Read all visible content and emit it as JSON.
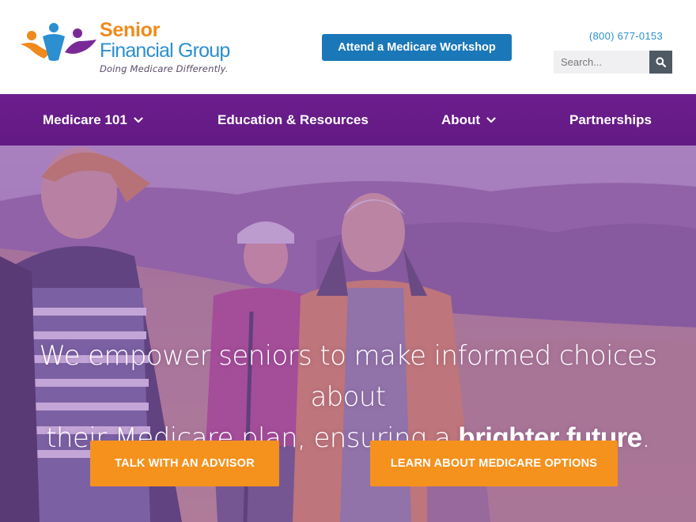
{
  "header": {
    "logo": {
      "word1": "Senior",
      "word2": "Financial Group",
      "tagline": "Doing Medicare Differently."
    },
    "workshop_button": "Attend a Medicare Workshop",
    "phone": "(800) 677-0153",
    "search": {
      "placeholder": "Search...",
      "value": ""
    }
  },
  "nav": {
    "items": [
      {
        "label": "Medicare 101",
        "has_dropdown": true
      },
      {
        "label": "Education & Resources",
        "has_dropdown": false
      },
      {
        "label": "About",
        "has_dropdown": true
      },
      {
        "label": "Partnerships",
        "has_dropdown": false
      }
    ]
  },
  "hero": {
    "line1": "We empower seniors to make informed choices about",
    "line2_a": "their Medicare plan, ensuring a ",
    "line2_b": "brighter future",
    "line2_c": ".",
    "cta_primary": "TALK WITH AN ADVISOR",
    "cta_secondary": "LEARN ABOUT MEDICARE OPTIONS"
  },
  "colors": {
    "brand_orange": "#f5921e",
    "brand_blue": "#2b8fd0",
    "brand_purple": "#6c1d8e",
    "button_blue": "#1a77b8"
  },
  "icons": {
    "search": "magnifier-icon",
    "dropdown": "chevron-down-icon",
    "logo_mark": "people-logo-icon"
  }
}
